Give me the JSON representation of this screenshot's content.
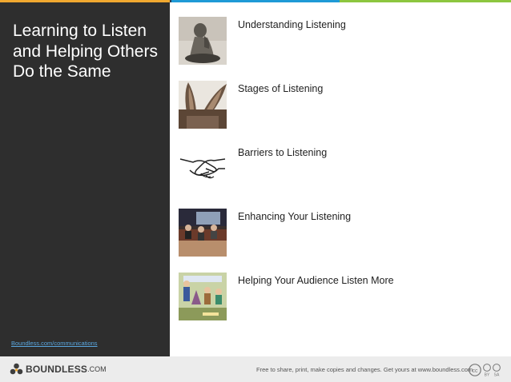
{
  "colors": {
    "top_bar": [
      "#f0a830",
      "#2f3b4c",
      "#1f9ad6",
      "#8dc63f"
    ],
    "sidebar_bg": "#2e2e2e",
    "link": "#5aa7e0",
    "footer_bg": "#ececec"
  },
  "sidebar": {
    "title": "Learning to Listen and Helping Others Do the Same",
    "link_text": "Boundless.com/communications"
  },
  "items": [
    {
      "label": "Understanding Listening",
      "icon": "statue-thinking-icon"
    },
    {
      "label": "Stages of Listening",
      "icon": "donkey-ears-icon"
    },
    {
      "label": "Barriers to Listening",
      "icon": "handshake-sketch-icon"
    },
    {
      "label": "Enhancing Your Listening",
      "icon": "panel-audience-icon"
    },
    {
      "label": "Helping Your Audience Listen More",
      "icon": "presentation-cartoon-icon"
    }
  ],
  "footer": {
    "brand_name": "BOUNDLESS",
    "brand_suffix": ".COM",
    "license_text": "Free to share, print, make copies and changes. Get yours at www.boundless.com",
    "cc_label": "cc",
    "by_label": "BY",
    "sa_label": "SA"
  }
}
